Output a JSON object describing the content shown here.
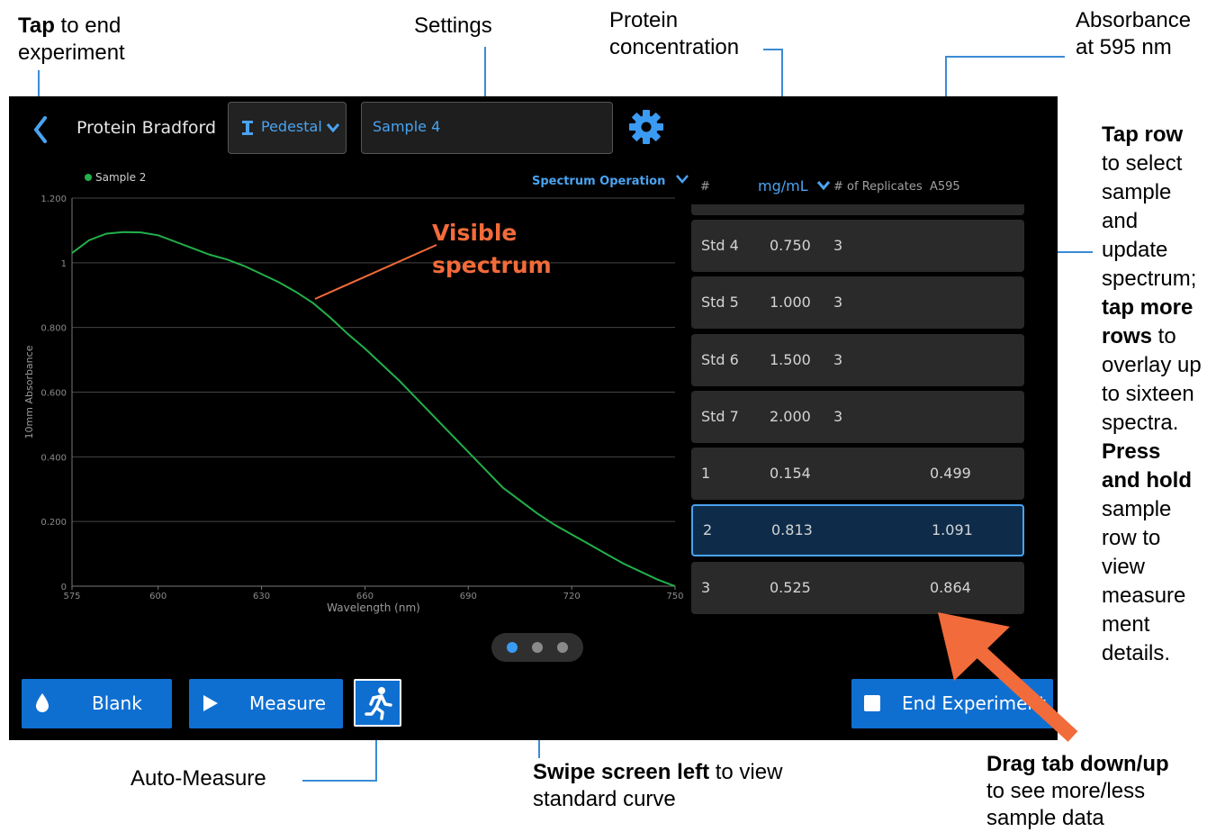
{
  "app": {
    "title": "Protein Bradford",
    "pedestal_label": "Pedestal",
    "sample_name": "Sample 4",
    "spectrum_operation": "Spectrum Operation",
    "legend_sample": "Sample 2"
  },
  "table": {
    "col_hash": "#",
    "col_unit": "mg/mL",
    "col_replicates": "# of Replicates",
    "col_a595": "A595",
    "rows": [
      {
        "id": "Std 4",
        "conc": "0.750",
        "reps": "3",
        "a595": ""
      },
      {
        "id": "Std 5",
        "conc": "1.000",
        "reps": "3",
        "a595": ""
      },
      {
        "id": "Std 6",
        "conc": "1.500",
        "reps": "3",
        "a595": ""
      },
      {
        "id": "Std 7",
        "conc": "2.000",
        "reps": "3",
        "a595": ""
      },
      {
        "id": "1",
        "conc": "0.154",
        "reps": "",
        "a595": "0.499"
      },
      {
        "id": "2",
        "conc": "0.813",
        "reps": "",
        "a595": "1.091"
      },
      {
        "id": "3",
        "conc": "0.525",
        "reps": "",
        "a595": "0.864"
      }
    ]
  },
  "buttons": {
    "blank": "Blank",
    "measure": "Measure",
    "end_experiment": "End Experiment"
  },
  "colors": {
    "accent": "#0f6fd1",
    "link": "#4aa3f0",
    "spectrum": "#22b04a",
    "callout_line": "#3b8bd6",
    "annotation": "#f26b3a"
  },
  "annotations": {
    "tap_bold": "Tap",
    "tap_rest": " to end",
    "tap_line2": "experiment",
    "settings": "Settings",
    "protein_line1": "Protein",
    "protein_line2": "concentration",
    "absorbance_line1": "Absorbance",
    "absorbance_line2": "at 595 nm",
    "visible_line1": "Visible",
    "visible_line2": "spectrum",
    "auto_measure": "Auto-Measure",
    "swipe_bold": "Swipe screen left",
    "swipe_rest": " to view",
    "swipe_line2": "standard curve",
    "drag_bold": "Drag tab down/up",
    "drag_line2": "to see more/less",
    "drag_line3": "sample data",
    "right_lines": [
      {
        "b": "Tap row",
        "t": ""
      },
      {
        "b": "",
        "t": "to select"
      },
      {
        "b": "",
        "t": "sample"
      },
      {
        "b": "",
        "t": "and"
      },
      {
        "b": "",
        "t": "update"
      },
      {
        "b": "",
        "t": "spectrum;"
      },
      {
        "b": "tap more",
        "t": ""
      },
      {
        "b": "rows",
        "t": " to"
      },
      {
        "b": "",
        "t": "overlay up"
      },
      {
        "b": "",
        "t": "to sixteen"
      },
      {
        "b": "",
        "t": "spectra."
      },
      {
        "b": "Press",
        "t": ""
      },
      {
        "b": "and hold",
        "t": ""
      },
      {
        "b": "",
        "t": "sample"
      },
      {
        "b": "",
        "t": "row to"
      },
      {
        "b": "",
        "t": "view"
      },
      {
        "b": "",
        "t": "measure"
      },
      {
        "b": "",
        "t": "ment"
      },
      {
        "b": "",
        "t": "details."
      }
    ]
  },
  "chart_data": {
    "type": "line",
    "xlabel": "Wavelength (nm)",
    "ylabel": "10mm Absorbance",
    "xlim": [
      575,
      750
    ],
    "ylim": [
      0,
      1.2
    ],
    "x_ticks": [
      "575",
      "600",
      "630",
      "660",
      "690",
      "720",
      "750"
    ],
    "y_ticks": [
      "0",
      "0.200",
      "0.400",
      "0.600",
      "0.800",
      "1",
      "1.200"
    ],
    "grid": true,
    "legend": "top-left",
    "series": [
      {
        "name": "Sample 2",
        "x": [
          575,
          580,
          585,
          590,
          595,
          600,
          605,
          610,
          615,
          620,
          625,
          630,
          635,
          640,
          645,
          650,
          655,
          660,
          665,
          670,
          675,
          680,
          685,
          690,
          695,
          700,
          705,
          710,
          715,
          720,
          725,
          730,
          735,
          740,
          745,
          750
        ],
        "y": [
          1.03,
          1.07,
          1.09,
          1.095,
          1.094,
          1.085,
          1.065,
          1.045,
          1.025,
          1.01,
          0.99,
          0.965,
          0.94,
          0.91,
          0.875,
          0.83,
          0.78,
          0.735,
          0.685,
          0.635,
          0.58,
          0.525,
          0.47,
          0.415,
          0.36,
          0.305,
          0.265,
          0.225,
          0.19,
          0.16,
          0.13,
          0.1,
          0.07,
          0.045,
          0.02,
          0.0
        ]
      }
    ]
  }
}
